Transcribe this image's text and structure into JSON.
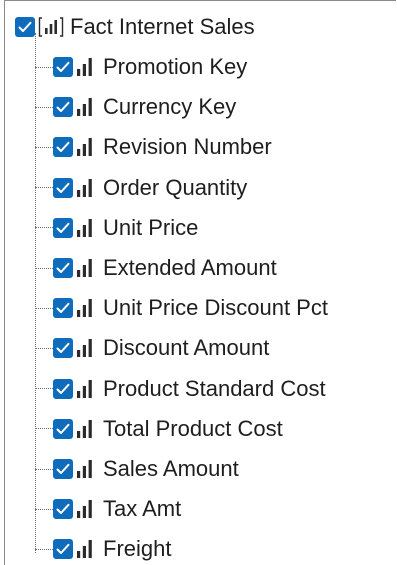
{
  "tree": {
    "root": {
      "label": "Fact Internet Sales",
      "checked": true,
      "icon": "table-icon"
    },
    "items": [
      {
        "label": "Promotion Key",
        "checked": true,
        "icon": "measure-icon"
      },
      {
        "label": "Currency Key",
        "checked": true,
        "icon": "measure-icon"
      },
      {
        "label": "Revision Number",
        "checked": true,
        "icon": "measure-icon"
      },
      {
        "label": "Order Quantity",
        "checked": true,
        "icon": "measure-icon"
      },
      {
        "label": "Unit Price",
        "checked": true,
        "icon": "measure-icon"
      },
      {
        "label": "Extended Amount",
        "checked": true,
        "icon": "measure-icon"
      },
      {
        "label": "Unit Price Discount Pct",
        "checked": true,
        "icon": "measure-icon"
      },
      {
        "label": "Discount Amount",
        "checked": true,
        "icon": "measure-icon"
      },
      {
        "label": "Product Standard Cost",
        "checked": true,
        "icon": "measure-icon"
      },
      {
        "label": "Total Product Cost",
        "checked": true,
        "icon": "measure-icon"
      },
      {
        "label": "Sales Amount",
        "checked": true,
        "icon": "measure-icon"
      },
      {
        "label": "Tax Amt",
        "checked": true,
        "icon": "measure-icon"
      },
      {
        "label": "Freight",
        "checked": true,
        "icon": "measure-icon"
      }
    ]
  },
  "colors": {
    "checkbox": "#0f6cbd",
    "text": "#1e1e1e",
    "icon": "#2b2b2b",
    "guide": "#707070"
  }
}
